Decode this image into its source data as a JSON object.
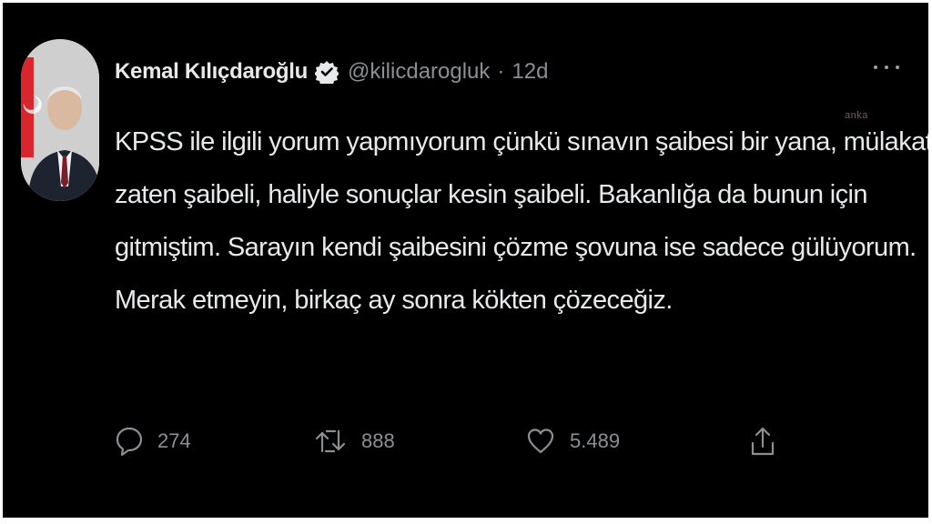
{
  "tweet": {
    "author_name": "Kemal Kılıçdaroğlu",
    "handle": "@kilicdarogluk",
    "separator": "·",
    "time": "12d",
    "text_lines": [
      "KPSS ile ilgili yorum yapmıyorum çünkü sınavın şaibesi bir yana, mülakatlar",
      "zaten şaibeli, haliyle sonuçlar kesin şaibeli. Bakanlığa da bunun için",
      "gitmiştim. Sarayın kendi şaibesini çözme şovuna ise sadece gülüyorum.",
      "Merak etmeyin, birkaç ay sonra kökten çözeceğiz."
    ],
    "watermark": "anka"
  },
  "actions": {
    "reply_count": "274",
    "retweet_count": "888",
    "like_count": "5.489"
  },
  "icons": {
    "verified": "verified-badge-icon",
    "more": "more-options-icon",
    "reply": "reply-icon",
    "retweet": "retweet-icon",
    "like": "heart-icon",
    "share": "share-icon"
  },
  "colors": {
    "background": "#000000",
    "text": "#e7e9ea",
    "muted": "#8b8f94"
  }
}
